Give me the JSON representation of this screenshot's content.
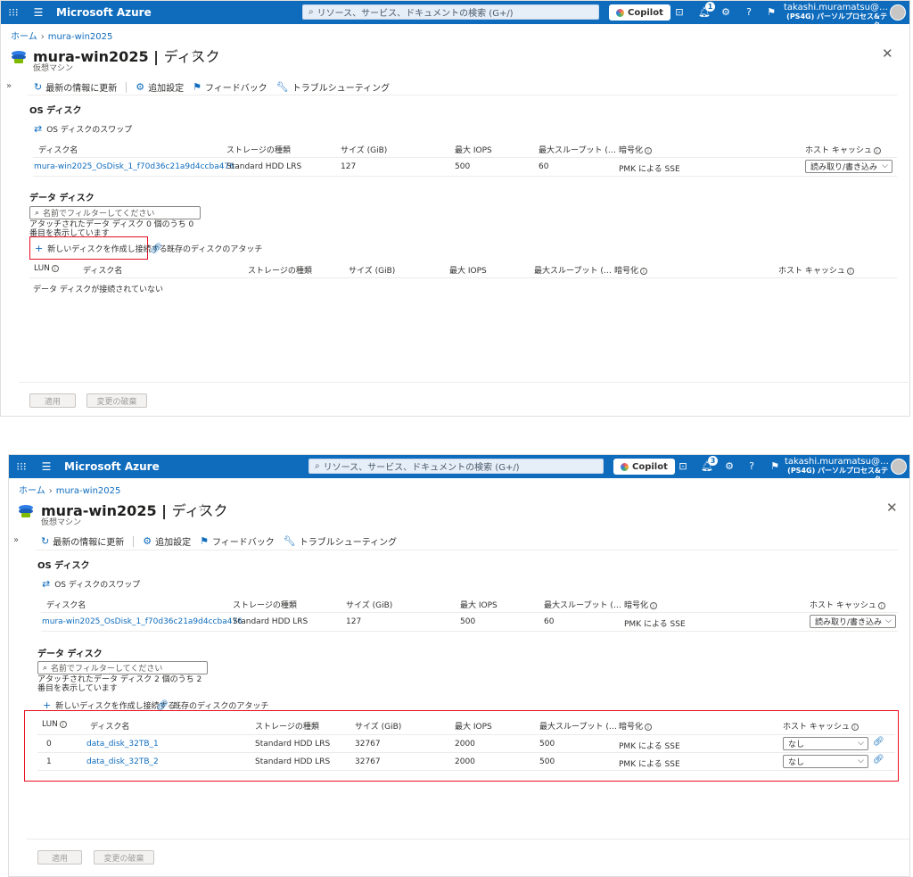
{
  "header": {
    "brand": "Microsoft Azure",
    "search_placeholder": "リソース、サービス、ドキュメントの検索 (G+/)",
    "copilot_label": "Copilot",
    "user_name": "takashi.muramatsu@…",
    "tenant": "(PS4G) パーソルプロセス&テク…",
    "notification_count_top": "1",
    "notification_count_bottom": "3"
  },
  "breadcrumb": {
    "home": "ホーム",
    "vm": "mura-win2025"
  },
  "page": {
    "title_name": "mura-win2025",
    "title_section": "ディスク",
    "subtitle": "仮想マシン"
  },
  "toolbar": {
    "refresh": "最新の情報に更新",
    "settings": "追加設定",
    "feedback": "フィードバック",
    "troubleshoot": "トラブルシューティング"
  },
  "os_disk": {
    "section_title": "OS ディスク",
    "swap_label": "OS ディスクのスワップ",
    "columns": {
      "name": "ディスク名",
      "storage": "ストレージの種類",
      "size": "サイズ (GiB)",
      "iops": "最大 IOPS",
      "throughput": "最大スループット (…",
      "encryption": "暗号化",
      "cache": "ホスト キャッシュ"
    },
    "row": {
      "name": "mura-win2025_OsDisk_1_f70d36c21a9d4ccba476",
      "storage": "Standard HDD LRS",
      "size": "127",
      "iops": "500",
      "throughput": "60",
      "encryption": "PMK による SSE",
      "cache": "読み取り/書き込み"
    }
  },
  "data_disk": {
    "section_title": "データ ディスク",
    "filter_placeholder": "名前でフィルターしてください",
    "count_top": "アタッチされたデータ ディスク 0 個のうち 0 番目を表示しています",
    "count_bottom": "アタッチされたデータ ディスク 2 個のうち 2 番目を表示しています",
    "create_label": "新しいディスクを作成し接続する",
    "attach_label": "既存のディスクのアタッチ",
    "columns": {
      "lun": "LUN",
      "name": "ディスク名",
      "storage": "ストレージの種類",
      "size": "サイズ (GiB)",
      "iops": "最大 IOPS",
      "throughput": "最大スループット (…",
      "encryption": "暗号化",
      "cache": "ホスト キャッシュ"
    },
    "empty_text": "データ ディスクが接続されていない",
    "rows": [
      {
        "lun": "0",
        "name": "data_disk_32TB_1",
        "storage": "Standard HDD LRS",
        "size": "32767",
        "iops": "2000",
        "throughput": "500",
        "encryption": "PMK による SSE",
        "cache": "なし"
      },
      {
        "lun": "1",
        "name": "data_disk_32TB_2",
        "storage": "Standard HDD LRS",
        "size": "32767",
        "iops": "2000",
        "throughput": "500",
        "encryption": "PMK による SSE",
        "cache": "なし"
      }
    ]
  },
  "footer": {
    "apply": "適用",
    "discard": "変更の破棄"
  },
  "colors": {
    "azure_blue": "#0f6cbd",
    "highlight_red": "#e81123"
  }
}
